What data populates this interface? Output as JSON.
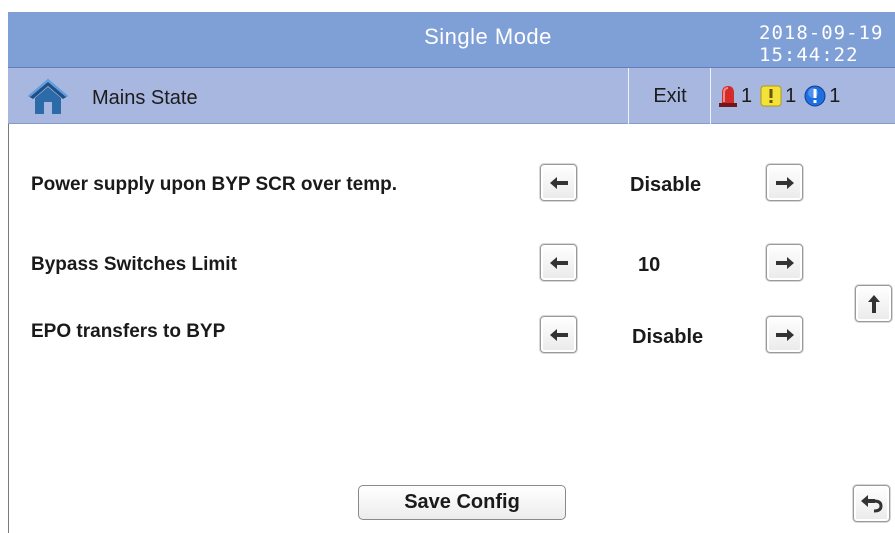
{
  "header": {
    "title": "Single Mode",
    "date": "2018-09-19",
    "time": "15:44:22"
  },
  "subbar": {
    "home_icon": "home-icon",
    "page_name": "Mains State",
    "exit_label": "Exit",
    "alarms": [
      {
        "icon": "red-alarm-beacon-icon",
        "count": "1",
        "color": "#d42a2a"
      },
      {
        "icon": "yellow-warning-icon",
        "count": "1",
        "color": "#f2e23a"
      },
      {
        "icon": "blue-info-icon",
        "count": "1",
        "color": "#1f6fe0"
      }
    ]
  },
  "settings": [
    {
      "label": "Power supply upon BYP SCR over temp.",
      "value": "Disable"
    },
    {
      "label": "Bypass  Switches Limit",
      "value": "10"
    },
    {
      "label": "EPO transfers to BYP",
      "value": "Disable"
    }
  ],
  "buttons": {
    "save_config": "Save  Config",
    "prev_icon": "left-arrow-icon",
    "next_icon": "right-arrow-icon",
    "page_up_icon": "up-arrow-icon",
    "back_icon": "return-arrow-icon"
  },
  "colors": {
    "title_bar": "#7f9fd7",
    "sub_bar": "#a8b7df"
  }
}
